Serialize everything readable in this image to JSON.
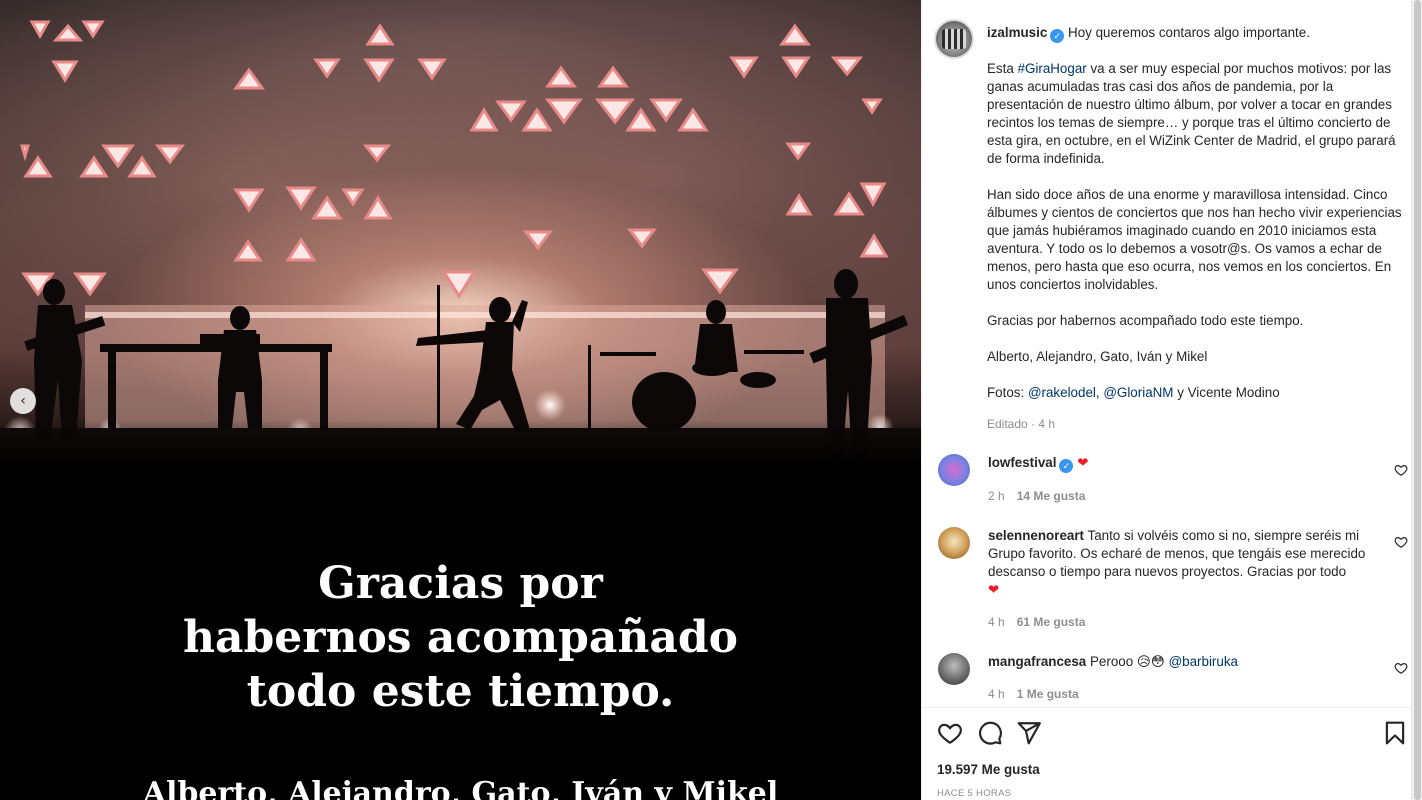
{
  "colors": {
    "accent_link": "#00376b",
    "muted": "#8e8e8e",
    "heart": "#ed1c24",
    "verified": "#3897f0"
  },
  "slide": {
    "line1": "Gracias por",
    "line2": "habernos acompañado",
    "line3": "todo este tiempo.",
    "names": "Alberto, Alejandro, Gato, Iván y Mikel"
  },
  "post": {
    "username": "izalmusic",
    "headline": "Hoy queremos contaros algo importante.",
    "p1_pre": "Esta ",
    "p1_tag": "#GiraHogar",
    "p1_post": " va a ser muy especial por muchos motivos: por las ganas acumuladas tras casi dos años de pandemia, por la presentación de nuestro último álbum, por volver a tocar en grandes recintos los temas de siempre… y porque tras el último concierto de esta gira, en octubre, en el WiZink Center de Madrid, el grupo parará de forma indefinida.",
    "p2": "Han sido doce años de una enorme y maravillosa intensidad. Cinco álbumes y cientos de conciertos que nos han hecho vivir experiencias que jamás hubiéramos imaginado cuando en 2010 iniciamos esta aventura. Y todo os lo debemos a vosotr@s. Os vamos a echar de menos, pero hasta que eso ocurra, nos vemos en los conciertos. En unos conciertos inolvidables.",
    "p3": "Gracias por habernos acompañado todo este tiempo.",
    "p4": "Alberto, Alejandro, Gato, Iván y Mikel",
    "p5_pre": "Fotos: ",
    "p5_m1": "@rakelodel",
    "p5_sep": ", ",
    "p5_m2": "@GloriaNM",
    "p5_post": " y Vicente Modino",
    "edited": "Editado · 4 h"
  },
  "comments": [
    {
      "user": "lowfestival",
      "text": "",
      "time": "2 h",
      "likes": "14 Me gusta"
    },
    {
      "user": "selennenoreart",
      "text": "Tanto si volvéis como si no, siempre seréis mi Grupo favorito. Os echaré de menos, que tengáis ese merecido descanso o tiempo para nuevos proyectos. Gracias por todo",
      "time": "4 h",
      "likes": "61 Me gusta"
    },
    {
      "user": "mangafrancesa",
      "text": "Perooo ",
      "mention": "@barbiruka",
      "time": "4 h",
      "likes": "1 Me gusta"
    }
  ],
  "footer": {
    "likes": "19.597 Me gusta",
    "time": "HACE 5 HORAS"
  },
  "icons": [
    "verified-icon",
    "heart-icon",
    "comment-icon",
    "share-icon",
    "save-icon",
    "chevron-left-icon"
  ]
}
